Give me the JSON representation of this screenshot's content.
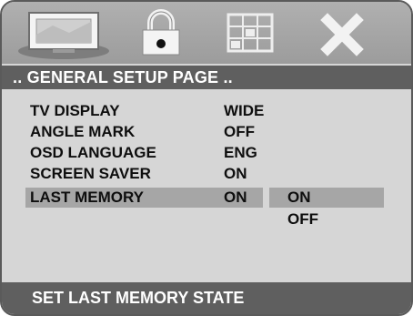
{
  "tabs": [
    {
      "icon": "tv-display-icon",
      "active": true
    },
    {
      "icon": "lock-icon",
      "active": false
    },
    {
      "icon": "grid-icon",
      "active": false
    },
    {
      "icon": "close-icon",
      "active": false
    }
  ],
  "page_title": ".. GENERAL SETUP PAGE ..",
  "settings": [
    {
      "label": "TV DISPLAY",
      "value": "WIDE"
    },
    {
      "label": "ANGLE MARK",
      "value": "OFF"
    },
    {
      "label": "OSD LANGUAGE",
      "value": "ENG"
    },
    {
      "label": "SCREEN SAVER",
      "value": "ON"
    },
    {
      "label": "LAST MEMORY",
      "value": "ON",
      "selected": true
    }
  ],
  "submenu": {
    "options": [
      "ON",
      "OFF"
    ],
    "highlighted": "ON"
  },
  "status_text": "SET LAST MEMORY STATE",
  "colors": {
    "background": "#d6d6d6",
    "bar": "#5f5f5f",
    "highlight": "#a6a6a6",
    "text": "#0e0e0e"
  }
}
